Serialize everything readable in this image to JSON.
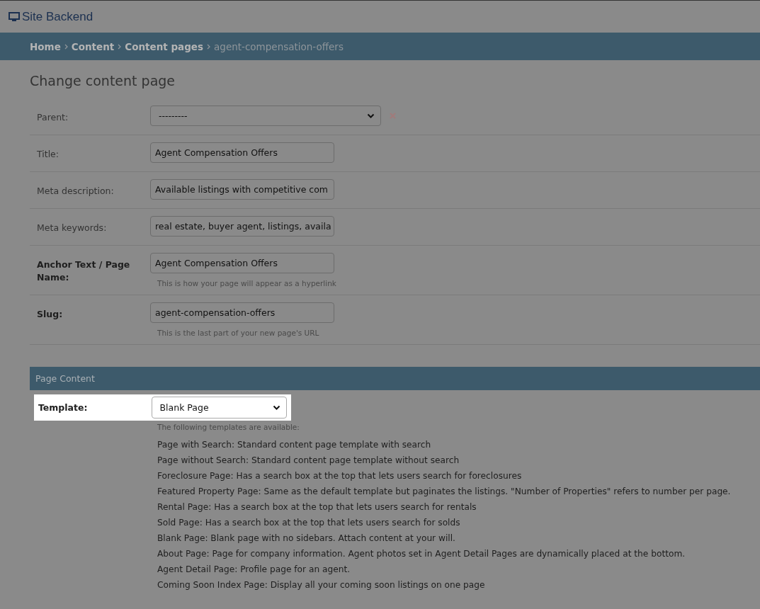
{
  "header": {
    "title": "Site Backend"
  },
  "breadcrumbs": [
    {
      "label": "Home",
      "current": false
    },
    {
      "label": "Content",
      "current": false
    },
    {
      "label": "Content pages",
      "current": false
    },
    {
      "label": "agent-compensation-offers",
      "current": true
    }
  ],
  "heading": "Change content page",
  "fields": [
    {
      "kind": "select",
      "label": "Parent:",
      "required": false,
      "value": "---------",
      "clearable": true
    },
    {
      "kind": "text",
      "label": "Title:",
      "required": false,
      "value": "Agent Compensation Offers"
    },
    {
      "kind": "text",
      "label": "Meta description:",
      "required": false,
      "value": "Available listings with competitive com"
    },
    {
      "kind": "text",
      "label": "Meta keywords:",
      "required": false,
      "value": "real estate, buyer agent, listings, availa"
    },
    {
      "kind": "text",
      "label": "Anchor Text / Page Name:",
      "required": true,
      "value": "Agent Compensation Offers",
      "help": "This is how your page will appear as a hyperlink"
    },
    {
      "kind": "text",
      "label": "Slug:",
      "required": true,
      "value": "agent-compensation-offers",
      "help": "This is the last part of your new page's URL"
    }
  ],
  "section": {
    "title": "Page Content",
    "template": {
      "label": "Template:",
      "value": "Blank Page",
      "highlighted": true,
      "help": "The following templates are available:",
      "options": [
        "Page with Search: Standard content page template with search",
        "Page without Search: Standard content page template without search",
        "Foreclosure Page: Has a search box at the top that lets users search for foreclosures",
        "Featured Property Page: Same as the default template but paginates the listings. \"Number of Properties\" refers to number per page.",
        "Rental Page: Has a search box at the top that lets users search for rentals",
        "Sold Page: Has a search box at the top that lets users search for solds",
        "Blank Page: Blank page with no sidebars. Attach content at your will.",
        "About Page: Page for company information. Agent photos set in Agent Detail Pages are dynamically placed at the bottom.",
        "Agent Detail Page: Profile page for an agent.",
        "Coming Soon Index Page: Display all your coming soon listings on one page"
      ]
    }
  }
}
